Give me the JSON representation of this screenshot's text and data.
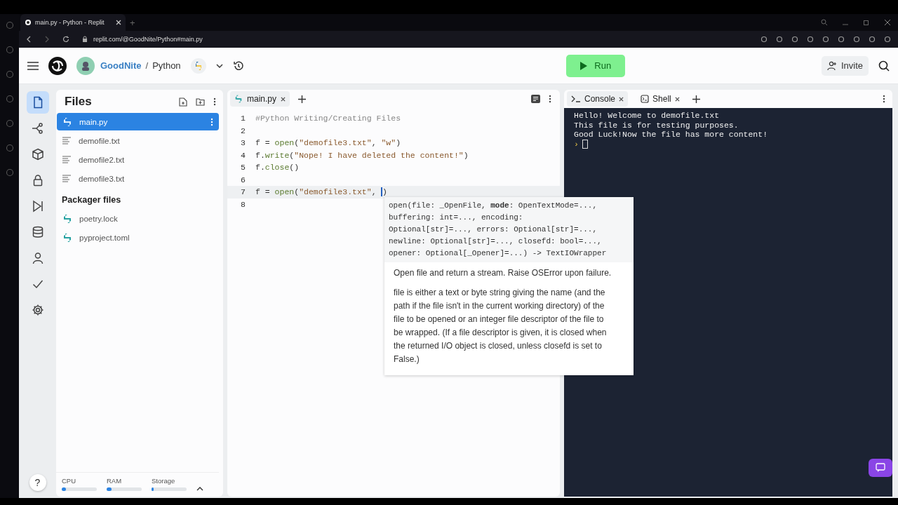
{
  "browser": {
    "tab_title": "main.py - Python - Replit",
    "new_tab": "+",
    "url": "replit.com/@GoodNite/Python#main.py"
  },
  "header": {
    "owner": "GoodNite",
    "separator": "/",
    "repl": "Python",
    "run": "Run",
    "invite": "Invite"
  },
  "rail": [
    {
      "kind": "files",
      "selected": true
    },
    {
      "kind": "git",
      "selected": false
    },
    {
      "kind": "packages",
      "selected": false
    },
    {
      "kind": "secrets",
      "selected": false
    },
    {
      "kind": "debugger",
      "selected": false
    },
    {
      "kind": "database",
      "selected": false
    },
    {
      "kind": "user",
      "selected": false
    },
    {
      "kind": "check",
      "selected": false
    },
    {
      "kind": "settings",
      "selected": false
    }
  ],
  "files": {
    "title": "Files",
    "items": [
      {
        "name": "main.py",
        "kind": "python",
        "selected": true
      },
      {
        "name": "demofile.txt",
        "kind": "text",
        "selected": false
      },
      {
        "name": "demofile2.txt",
        "kind": "text",
        "selected": false
      },
      {
        "name": "demofile3.txt",
        "kind": "text",
        "selected": false
      }
    ],
    "packager_title": "Packager files",
    "packager_items": [
      {
        "name": "poetry.lock",
        "kind": "python",
        "selected": false
      },
      {
        "name": "pyproject.toml",
        "kind": "python",
        "selected": false
      }
    ]
  },
  "editor": {
    "tabs": [
      {
        "label": "main.py",
        "selected": true
      }
    ],
    "lines": [
      {
        "number": "1",
        "current": false,
        "tokens": [
          {
            "text": "#Python Writing/Creating Files",
            "kind": "comment"
          }
        ]
      },
      {
        "number": "2",
        "current": false
      },
      {
        "number": "3",
        "current": false,
        "tokens": [
          {
            "text": "f = ",
            "kind": "plain"
          },
          {
            "text": "open",
            "kind": "func"
          },
          {
            "text": "(",
            "kind": "plain"
          },
          {
            "text": "\"demofile3.txt\"",
            "kind": "string"
          },
          {
            "text": ", ",
            "kind": "plain"
          },
          {
            "text": "\"w\"",
            "kind": "string"
          },
          {
            "text": ")",
            "kind": "plain"
          }
        ]
      },
      {
        "number": "4",
        "current": false,
        "tokens": [
          {
            "text": "f.",
            "kind": "plain"
          },
          {
            "text": "write",
            "kind": "func"
          },
          {
            "text": "(",
            "kind": "plain"
          },
          {
            "text": "\"Nope! I have deleted the content!\"",
            "kind": "string"
          },
          {
            "text": ")",
            "kind": "plain"
          }
        ]
      },
      {
        "number": "5",
        "current": false,
        "tokens": [
          {
            "text": "f.",
            "kind": "plain"
          },
          {
            "text": "close",
            "kind": "func"
          },
          {
            "text": "()",
            "kind": "plain"
          }
        ]
      },
      {
        "number": "6",
        "current": false
      },
      {
        "number": "7",
        "current": true,
        "tokens": [
          {
            "text": "f = ",
            "kind": "plain"
          },
          {
            "text": "open",
            "kind": "func"
          },
          {
            "text": "(",
            "kind": "plain"
          },
          {
            "text": "\"demofile3.txt\"",
            "kind": "string"
          },
          {
            "text": ", ",
            "kind": "plain"
          },
          {
            "kind": "caret"
          },
          {
            "text": ")",
            "kind": "plain"
          }
        ]
      },
      {
        "number": "8",
        "current": false
      }
    ]
  },
  "autocomplete": {
    "signature": [
      "open(file: _OpenFile, **mode**: OpenTextMode=...,",
      "buffering: int=..., encoding:",
      "Optional[str]=..., errors: Optional[str]=...,",
      "newline: Optional[str]=..., closefd: bool=...,",
      "opener: Optional[_Opener]=...) -> TextIOWrapper"
    ],
    "doc": [
      "Open file and return a stream.  Raise OSError upon failure.",
      "file is either a text or byte string giving the name (and the path if the file isn't in the current working directory) of the file to be opened or an integer file descriptor of the file to be wrapped. (If a file descriptor is given, it is closed when the returned I/O object is closed, unless closefd is set to False.)"
    ]
  },
  "console": {
    "tabs": [
      {
        "label": "Console",
        "kind": "console",
        "selected": true
      },
      {
        "label": "Shell",
        "kind": "shell",
        "selected": false
      }
    ],
    "output": [
      "Hello! Welcome to demofile.txt",
      "This file is for testing purposes.",
      "Good Luck!Now the file has more content!"
    ],
    "prompt": "›"
  },
  "help": "?",
  "resources": [
    {
      "label": "CPU",
      "level": 0.12
    },
    {
      "label": "RAM",
      "level": 0.14
    },
    {
      "label": "Storage",
      "level": 0.06
    }
  ]
}
